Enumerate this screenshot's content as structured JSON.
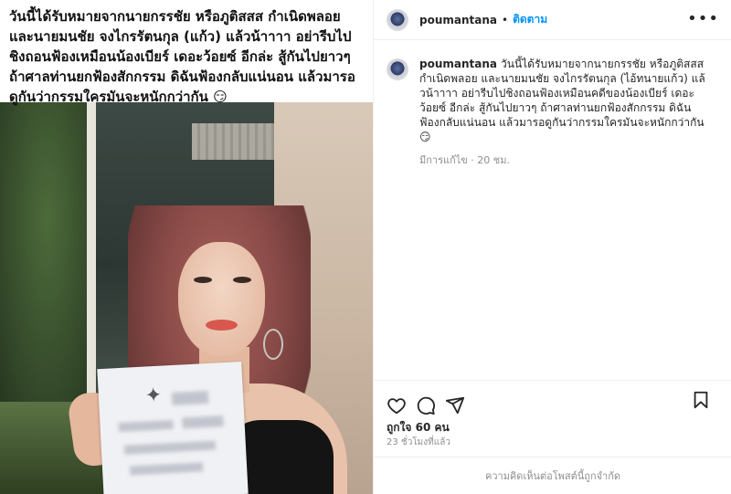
{
  "photo": {
    "caption_overlay": "วันนี้ได้รับหมายจากนายกรรชัย หรือภูติสสส กำเนิดพลอย และนายมนชัย จงไกรรัตนกุล (แก้ว) แล้วน้าาาา อย่ารีบไปชิงถอนฟ้องเหมือนน้องเบียร์ เดอะว้อยซ์ อีกล่ะ สู้กันไปยาวๆ ถ้าศาลท่านยกฟ้องสักกรรม ดิฉันฟ้องกลับแน่นอน แล้วมารอดูกันว่ากรรมใครมันจะหนักกว่ากัน 😏"
  },
  "header": {
    "username": "poumantana",
    "separator": "•",
    "follow_label": "ติดตาม",
    "more_label": "•••"
  },
  "caption": {
    "username": "poumantana",
    "text": "วันนี้ได้รับหมายจากนายกรรชัย หรือภูติสสส กำเนิดพลอย และนายมนชัย จงไกรรัตนกุล (ไอ้ทนายแก้ว) แล้วน้าาาา อย่ารีบไปชิงถอนฟ้องเหมือนคดีของน้องเบียร์ เดอะว้อยซ์ อีกล่ะ สู้กันไปยาวๆ ถ้าศาลท่านยกฟ้องสักกรรม ดิฉันฟ้องกลับแน่นอน แล้วมารอดูกันว่ากรรมใครมันจะหนักกว่ากัน 😏",
    "meta": "มีการแก้ไข · 20 ชม."
  },
  "actions": {
    "like_icon": "heart-icon",
    "comment_icon": "comment-icon",
    "share_icon": "share-icon",
    "save_icon": "bookmark-icon"
  },
  "stats": {
    "likes": "ถูกใจ 60 คน",
    "timestamp": "23 ชั่วโมงที่แล้ว"
  },
  "footer": {
    "comments_closed": "ความคิดเห็นต่อโพสต์นี้ถูกจำกัด"
  },
  "colors": {
    "link_blue": "#0095f6",
    "muted": "#8e8e8e",
    "text": "#262626",
    "border": "#efefef"
  }
}
